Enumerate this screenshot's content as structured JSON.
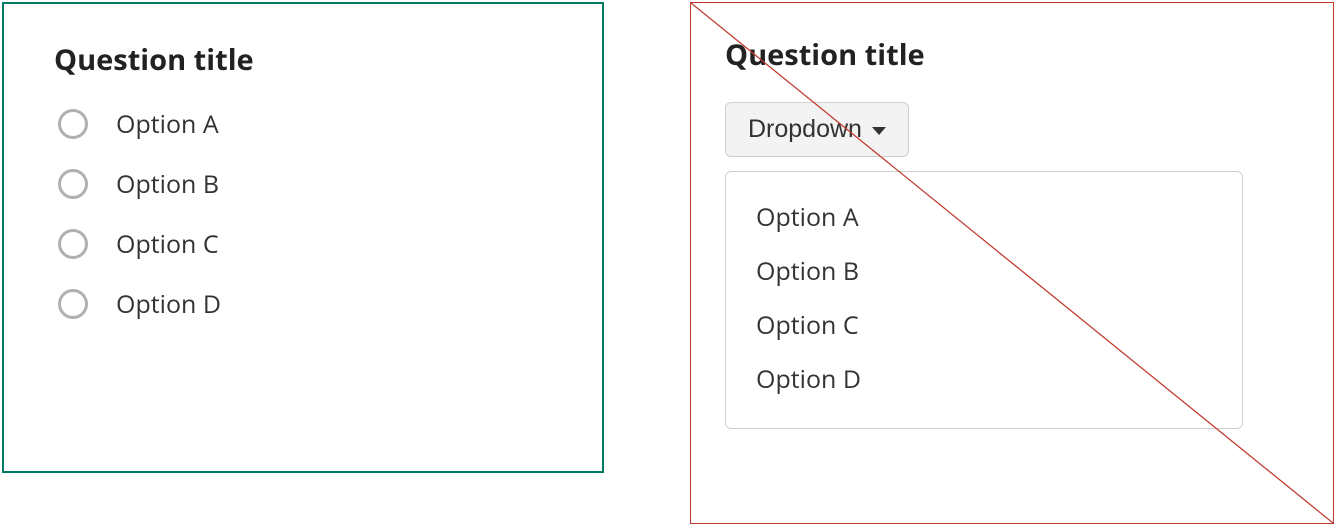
{
  "good": {
    "title": "Question title",
    "options": [
      "Option A",
      "Option B",
      "Option C",
      "Option D"
    ]
  },
  "bad": {
    "title": "Question title",
    "dropdown_label": "Dropdown",
    "options": [
      "Option A",
      "Option B",
      "Option C",
      "Option D"
    ]
  }
}
